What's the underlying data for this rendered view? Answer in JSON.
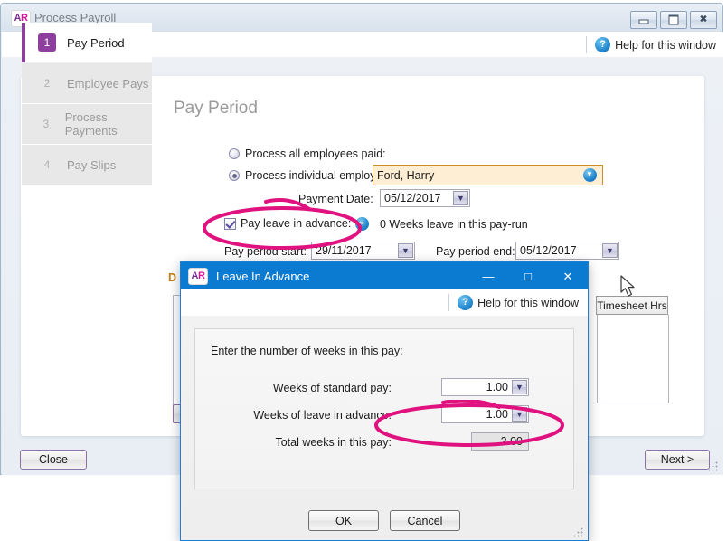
{
  "main_window": {
    "app_badge": "AR",
    "title": "Process Payroll",
    "help_label": "Help for this window",
    "help_icon": "question-mark-icon",
    "window_controls": {
      "minimize": "minimize-icon",
      "maximize": "maximize-icon",
      "close": "close-icon"
    }
  },
  "steps": [
    {
      "num": "1",
      "label": "Pay Period",
      "active": true
    },
    {
      "num": "2",
      "label": "Employee Pays",
      "active": false
    },
    {
      "num": "3",
      "label": "Process Payments",
      "active": false
    },
    {
      "num": "4",
      "label": "Pay Slips",
      "active": false
    }
  ],
  "page": {
    "title": "Pay Period",
    "radio_all_label": "Process all employees paid:",
    "radio_individual_label": "Process individual employee:",
    "employee_value": "Ford, Harry",
    "payment_date_label": "Payment Date:",
    "payment_date_value": "05/12/2017",
    "pay_leave_label": "Pay leave in advance:",
    "pay_leave_checked": true,
    "leave_summary": "0 Weeks leave in this pay-run",
    "advance_icon": "circular-arrow-icon",
    "period_start_label": "Pay period start:",
    "period_start_value": "29/11/2017",
    "period_end_label": "Pay period end:",
    "period_end_value": "05/12/2017",
    "behind_label": "D",
    "timesheet_tab_label": "Timesheet Hrs"
  },
  "footer": {
    "close_label": "Close",
    "next_label": "Next >"
  },
  "dialog": {
    "app_badge": "AR",
    "title": "Leave In Advance",
    "help_label": "Help for this window",
    "help_icon": "question-mark-icon",
    "window_controls": {
      "minimize": "—",
      "maximize": "□",
      "close": "✕"
    },
    "intro": "Enter the number of weeks in this pay:",
    "standard_pay_label": "Weeks of standard pay:",
    "standard_pay_value": "1.00",
    "leave_advance_label": "Weeks of leave in advance:",
    "leave_advance_value": "1.00",
    "total_weeks_label": "Total weeks in this pay:",
    "total_weeks_value": "2.00",
    "ok_label": "OK",
    "cancel_label": "Cancel"
  },
  "colors": {
    "accent_purple": "#8e3f9e",
    "dialog_blue": "#0b7ad1",
    "annotation_pink": "#e0127f",
    "highlight_field": "#fdeed4",
    "highlight_border": "#c98e2e"
  },
  "annotations": [
    {
      "name": "pay-leave-in-advance-ellipse",
      "shape": "ellipse-with-tail"
    },
    {
      "name": "weeks-of-leave-in-advance-ellipse",
      "shape": "ellipse-with-tail"
    }
  ]
}
